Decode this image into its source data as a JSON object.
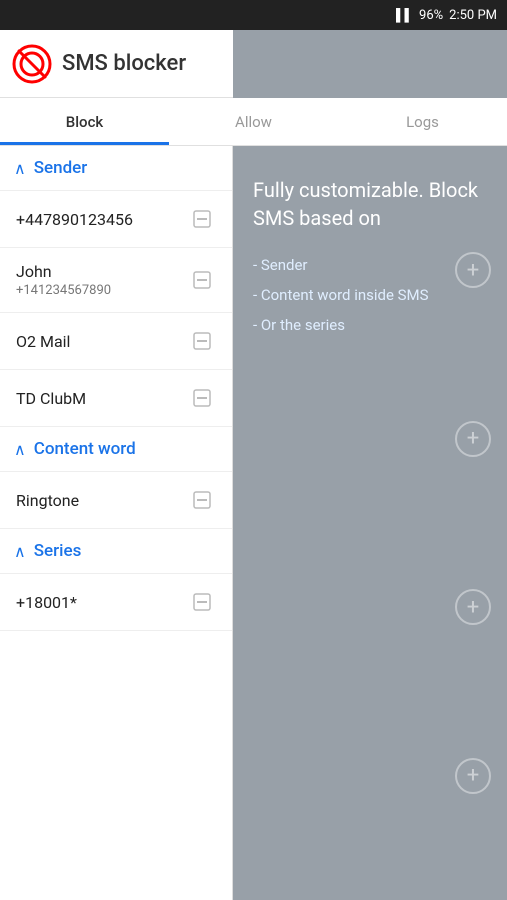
{
  "statusBar": {
    "signal": "▌▌",
    "battery": "96%",
    "time": "2:50 PM"
  },
  "header": {
    "title": "SMS blocker"
  },
  "tabs": [
    {
      "label": "Block",
      "active": true
    },
    {
      "label": "Allow",
      "active": false
    },
    {
      "label": "Logs",
      "active": false
    }
  ],
  "leftPanel": {
    "sections": [
      {
        "id": "sender",
        "title": "Sender",
        "items": [
          {
            "title": "+447890123456",
            "subtitle": ""
          },
          {
            "title": "John",
            "subtitle": "+141234567890"
          },
          {
            "title": "O2 Mail",
            "subtitle": ""
          },
          {
            "title": "TD ClubM",
            "subtitle": ""
          }
        ]
      },
      {
        "id": "content-word",
        "title": "Content word",
        "items": [
          {
            "title": "Ringtone",
            "subtitle": ""
          }
        ]
      },
      {
        "id": "series",
        "title": "Series",
        "items": [
          {
            "title": "+18001*",
            "subtitle": ""
          }
        ]
      }
    ]
  },
  "overlay": {
    "title": "Fully customizable. Block SMS based on",
    "listItems": [
      "- Sender",
      "- Content word inside SMS",
      "- Or the series"
    ]
  },
  "icons": {
    "chevronUp": "∧",
    "plus": "+",
    "noSign": "🚫"
  }
}
